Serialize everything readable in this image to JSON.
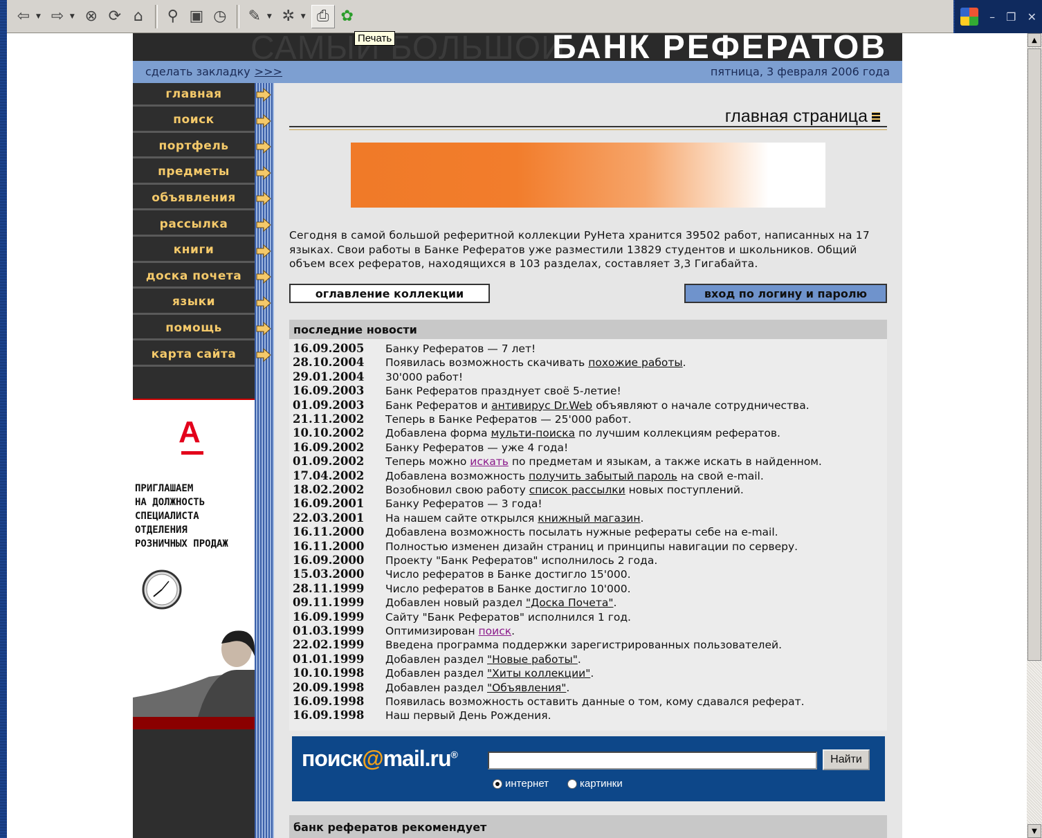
{
  "browser": {
    "tooltip": "Печать",
    "toolbar_icons": [
      "back-icon",
      "forward-icon",
      "stop-icon",
      "refresh-icon",
      "home-icon",
      "search-icon",
      "favorites-icon",
      "history-icon",
      "edit-icon",
      "tools-icon",
      "print-icon",
      "icq-icon"
    ]
  },
  "site": {
    "banner_ghost": "САМЫЙ БОЛЬШОЙ",
    "banner_title": "БАНК РЕФЕРАТОВ",
    "bookmark_label": "сделать закладку",
    "bookmark_link": ">>>",
    "date": "пятница, 3 февраля 2006 года"
  },
  "nav": {
    "items": [
      "главная",
      "поиск",
      "портфель",
      "предметы",
      "объявления",
      "рассылка",
      "книги",
      "доска почета",
      "языки",
      "помощь",
      "карта сайта"
    ]
  },
  "ad": {
    "logo": "А",
    "text": "ПРИГЛАШАЕМ\nНА ДОЛЖНОСТЬ\nСПЕЦИАЛИСТА\nОТДЕЛЕНИЯ\nРОЗНИЧНЫХ ПРОДАЖ"
  },
  "content": {
    "page_title": "главная страница",
    "intro": "Сегодня в самой большой реферитной коллекции РуНета хранится 39502 работ, написанных на 17 языках. Свои работы в Банке Рефератов уже разместили 13829 студентов и школьников. Общий объем всех рефератов, находящихся в 103 разделах, составляет 3,3 Гигабайта.",
    "btn_toc": "оглавление коллекции",
    "btn_login": "вход по логину и паролю",
    "news_heading": "последние новости",
    "recommend_heading": "банк рефератов рекомендует"
  },
  "news": [
    {
      "date": "16.09.2005",
      "pre": "Банку Рефератов — 7 лет!",
      "link": "",
      "post": ""
    },
    {
      "date": "28.10.2004",
      "pre": "Появилась возможность скачивать ",
      "link": "похожие работы",
      "post": "."
    },
    {
      "date": "29.01.2004",
      "pre": "30'000 работ!",
      "link": "",
      "post": ""
    },
    {
      "date": "16.09.2003",
      "pre": "Банк Рефератов празднует своё 5-летие!",
      "link": "",
      "post": ""
    },
    {
      "date": "01.09.2003",
      "pre": "Банк Рефератов и ",
      "link": "антивирус Dr.Web",
      "post": " объявляют о начале сотрудничества."
    },
    {
      "date": "21.11.2002",
      "pre": "Теперь в Банке Рефератов — 25'000 работ.",
      "link": "",
      "post": ""
    },
    {
      "date": "10.10.2002",
      "pre": "Добавлена форма ",
      "link": "мульти-поиска",
      "post": " по лучшим коллекциям рефератов."
    },
    {
      "date": "16.09.2002",
      "pre": "Банку Рефератов — уже 4 года!",
      "link": "",
      "post": ""
    },
    {
      "date": "01.09.2002",
      "pre": "Теперь можно ",
      "link": "искать",
      "post": " по предметам и языкам, а также искать в найденном.",
      "visited": true
    },
    {
      "date": "17.04.2002",
      "pre": "Добавлена возможность ",
      "link": "получить забытый пароль",
      "post": " на свой e-mail."
    },
    {
      "date": "18.02.2002",
      "pre": "Возобновил свою работу ",
      "link": "список рассылки",
      "post": " новых поступлений."
    },
    {
      "date": "16.09.2001",
      "pre": "Банку Рефератов — 3 года!",
      "link": "",
      "post": ""
    },
    {
      "date": "22.03.2001",
      "pre": "На нашем сайте открылся ",
      "link": "книжный магазин",
      "post": "."
    },
    {
      "date": "16.11.2000",
      "pre": "Добавлена возможность посылать нужные рефераты себе на e-mail.",
      "link": "",
      "post": ""
    },
    {
      "date": "16.11.2000",
      "pre": "Полностью изменен дизайн страниц и принципы навигации по серверу.",
      "link": "",
      "post": ""
    },
    {
      "date": "16.09.2000",
      "pre": "Проекту \"Банк Рефератов\" исполнилось 2 года.",
      "link": "",
      "post": ""
    },
    {
      "date": "15.03.2000",
      "pre": "Число рефератов в Банке достигло 15'000.",
      "link": "",
      "post": ""
    },
    {
      "date": "28.11.1999",
      "pre": "Число рефератов в Банке достигло 10'000.",
      "link": "",
      "post": ""
    },
    {
      "date": "09.11.1999",
      "pre": "Добавлен новый раздел ",
      "link": "\"Доска Почета\"",
      "post": "."
    },
    {
      "date": "16.09.1999",
      "pre": "Сайту \"Банк Рефератов\" исполнился 1 год.",
      "link": "",
      "post": ""
    },
    {
      "date": "01.03.1999",
      "pre": "Оптимизирован ",
      "link": "поиск",
      "post": ".",
      "visited": true
    },
    {
      "date": "22.02.1999",
      "pre": "Введена программа поддержки зарегистрированных пользователей.",
      "link": "",
      "post": ""
    },
    {
      "date": "01.01.1999",
      "pre": "Добавлен раздел ",
      "link": "\"Новые работы\"",
      "post": "."
    },
    {
      "date": "10.10.1998",
      "pre": "Добавлен раздел ",
      "link": "\"Хиты коллекции\"",
      "post": "."
    },
    {
      "date": "20.09.1998",
      "pre": "Добавлен раздел ",
      "link": "\"Объявления\"",
      "post": "."
    },
    {
      "date": "16.09.1998",
      "pre": "Появилась возможность оставить данные о том, кому сдавался реферат.",
      "link": "",
      "post": ""
    },
    {
      "date": "16.09.1998",
      "pre": "Наш первый День Рождения.",
      "link": "",
      "post": ""
    }
  ],
  "search": {
    "logo_a": "поиск",
    "logo_at": "@",
    "logo_b": "mail.ru",
    "logo_reg": "®",
    "button": "Найти",
    "input_value": "",
    "radio_internet": "интернет",
    "radio_images": "картинки"
  },
  "colors": {
    "accent_orange": "#f07a28",
    "nav_text": "#f4c96a",
    "infobar": "#7d9fd1",
    "search_bg": "#0d4789"
  }
}
